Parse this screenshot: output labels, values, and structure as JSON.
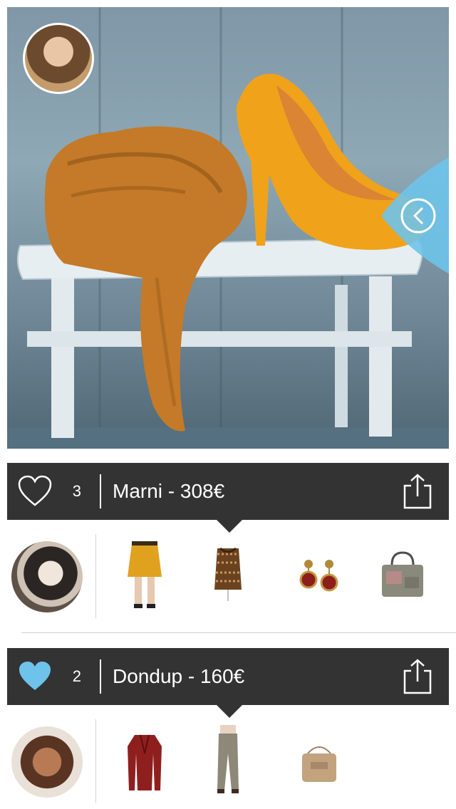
{
  "posts": [
    {
      "likes": "3",
      "title": "Marni - 308€",
      "liked": false,
      "products": [
        "yellow-skirt",
        "patterned-top",
        "drop-earrings",
        "tote-bag"
      ]
    },
    {
      "likes": "2",
      "title": "Dondup - 160€",
      "liked": true,
      "products": [
        "red-jacket",
        "grey-trousers",
        "beige-crossbody-bag"
      ]
    }
  ],
  "colors": {
    "bar_bg": "#333333",
    "accent_blue": "#6ec3ea",
    "shoe_yellow": "#f0a21a",
    "scarf_orange": "#c47a28"
  }
}
